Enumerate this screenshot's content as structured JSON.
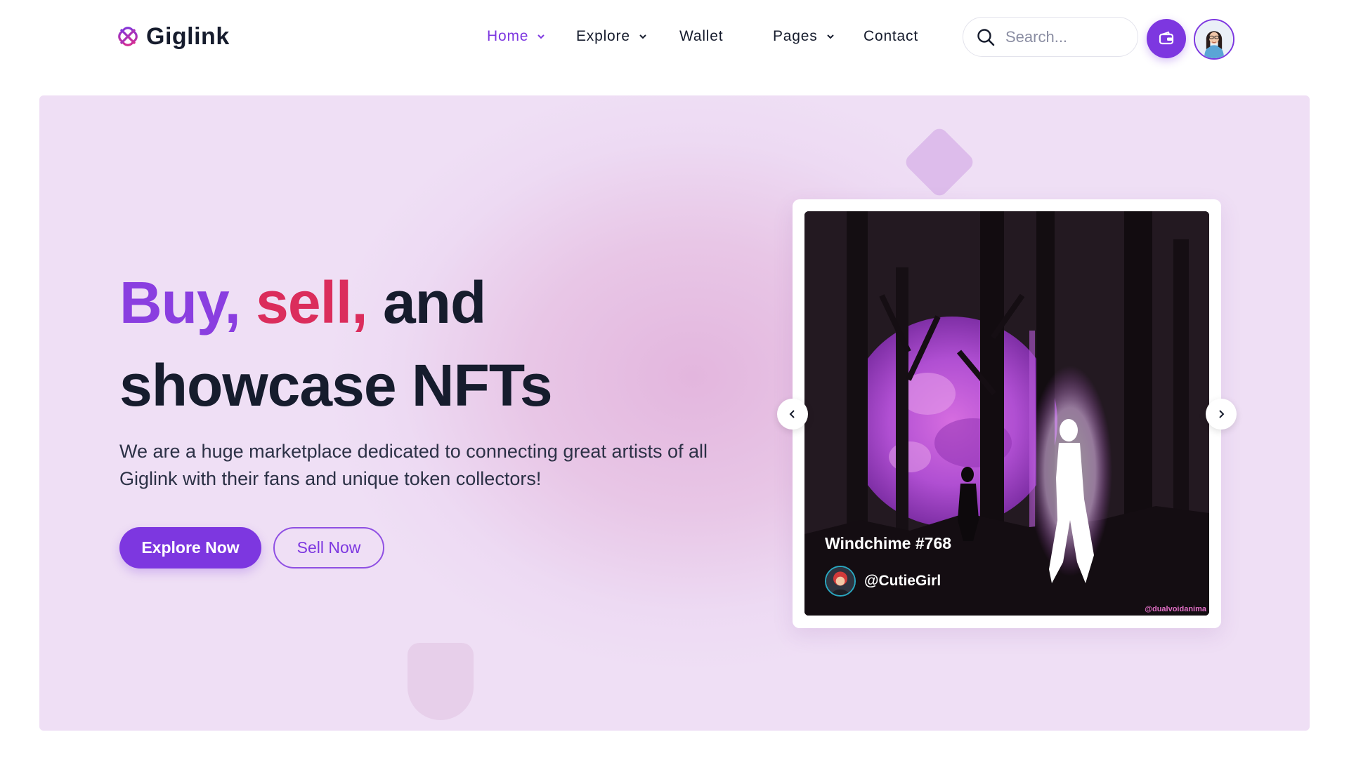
{
  "brand": {
    "name": "Giglink",
    "accent": "#7d37e0",
    "logo_color": "#a12ce0"
  },
  "nav": {
    "items": [
      {
        "label": "Home",
        "dropdown": true,
        "active": true
      },
      {
        "label": "Explore",
        "dropdown": true,
        "active": false
      },
      {
        "label": "Wallet",
        "dropdown": false,
        "active": false
      },
      {
        "label": "Pages",
        "dropdown": true,
        "active": false
      },
      {
        "label": "Contact",
        "dropdown": false,
        "active": false
      }
    ]
  },
  "search": {
    "placeholder": "Search...",
    "value": "",
    "icon": "search-icon"
  },
  "header_actions": {
    "wallet_icon": "wallet-icon",
    "avatar_icon": "user-avatar"
  },
  "hero": {
    "headline_part1": "Buy,",
    "headline_part2": "sell,",
    "headline_part3": "and",
    "headline_line2": "showcase NFTs",
    "headline_colors": {
      "part1": "#8a3ee0",
      "part2": "#db2d5c",
      "rest": "#161c2d"
    },
    "description": "We are a huge marketplace dedicated to connecting great artists of all Giglink with their fans and unique token collectors!",
    "primary_button": "Explore Now",
    "secondary_button": "Sell Now"
  },
  "nft_card": {
    "title": "Windchime #768",
    "owner": "@CutieGirl",
    "watermark": "@dualvoidanima",
    "prev_icon": "chevron-left-icon",
    "next_icon": "chevron-right-icon"
  }
}
